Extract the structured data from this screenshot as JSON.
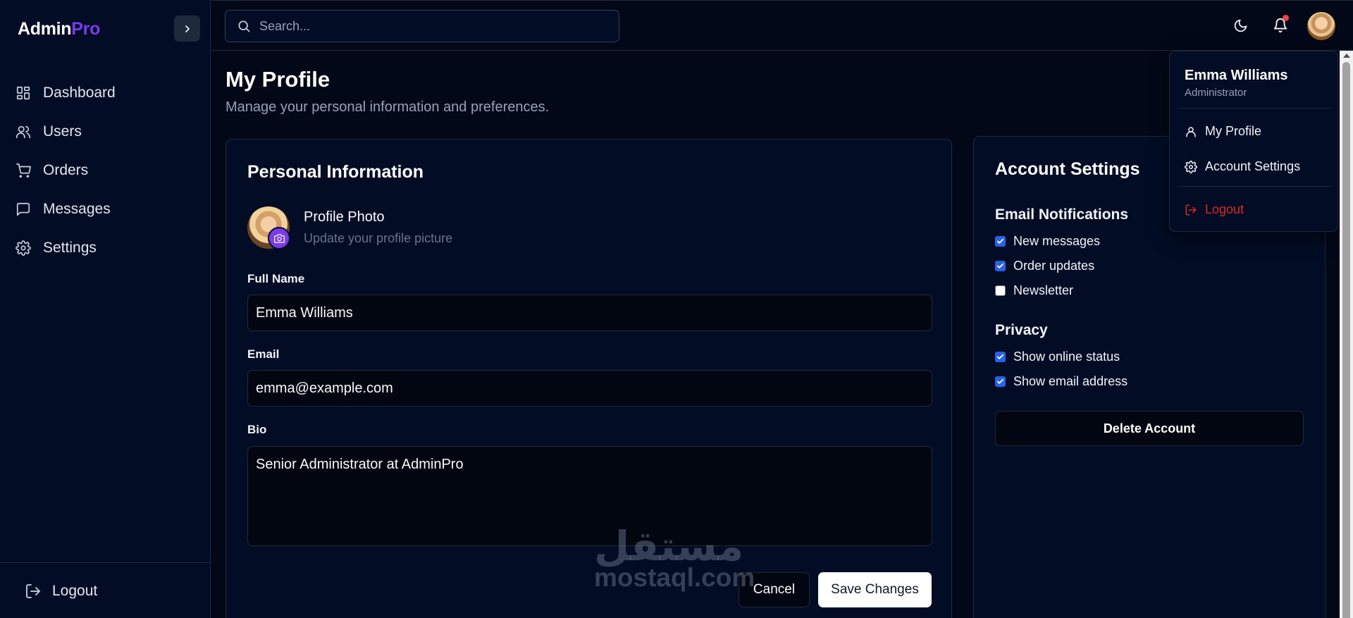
{
  "brand": {
    "name": "Admin",
    "accent": "Pro",
    "accent_color": "#7c3aed"
  },
  "sidebar": {
    "items": [
      {
        "label": "Dashboard",
        "icon": "dashboard-icon"
      },
      {
        "label": "Users",
        "icon": "users-icon"
      },
      {
        "label": "Orders",
        "icon": "cart-icon"
      },
      {
        "label": "Messages",
        "icon": "message-icon"
      },
      {
        "label": "Settings",
        "icon": "gear-icon"
      }
    ],
    "logout_label": "Logout"
  },
  "header": {
    "search_placeholder": "Search...",
    "has_notification": true
  },
  "page": {
    "title": "My Profile",
    "subtitle": "Manage your personal information and preferences."
  },
  "personal": {
    "title": "Personal Information",
    "photo_title": "Profile Photo",
    "photo_subtitle": "Update your profile picture",
    "full_name_label": "Full Name",
    "full_name_value": "Emma Williams",
    "email_label": "Email",
    "email_value": "emma@example.com",
    "bio_label": "Bio",
    "bio_value": "Senior Administrator at AdminPro",
    "cancel_label": "Cancel",
    "save_label": "Save Changes"
  },
  "account": {
    "title": "Account Settings",
    "email_notifications_title": "Email Notifications",
    "email_notifications": [
      {
        "label": "New messages",
        "checked": true
      },
      {
        "label": "Order updates",
        "checked": true
      },
      {
        "label": "Newsletter",
        "checked": false
      }
    ],
    "privacy_title": "Privacy",
    "privacy": [
      {
        "label": "Show online status",
        "checked": true
      },
      {
        "label": "Show email address",
        "checked": true
      }
    ],
    "delete_label": "Delete Account"
  },
  "user_menu": {
    "name": "Emma Williams",
    "role": "Administrator",
    "items": [
      {
        "label": "My Profile",
        "icon": "user-icon"
      },
      {
        "label": "Account Settings",
        "icon": "gear-icon"
      }
    ],
    "logout_label": "Logout"
  },
  "watermark": {
    "arabic": "مستقل",
    "latin": "mostaql.com"
  }
}
